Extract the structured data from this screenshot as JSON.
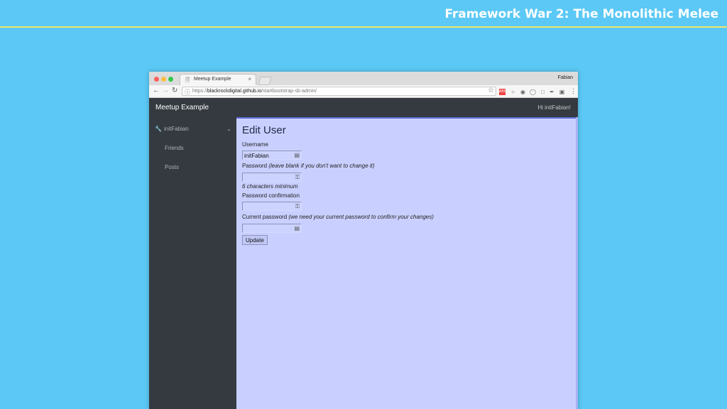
{
  "slide": {
    "title": "Framework War 2: The Monolithic Melee"
  },
  "browser": {
    "tab_title": "Meetup Example",
    "tab_icon": "page-icon",
    "profile_name": "Fabian",
    "url_prefix": "https://",
    "url_host": "blackrockdigital.github.io",
    "url_path": "/startbootstrap-sb-admin/"
  },
  "app": {
    "brand": "Meetup Example",
    "greeting": "Hi initFabian!",
    "sidebar": {
      "user_label": "initFabian",
      "items": [
        {
          "label": "Friends"
        },
        {
          "label": "Posts"
        }
      ]
    },
    "form": {
      "title": "Edit User",
      "username_label": "Username",
      "username_value": "initFabian",
      "password_label": "Password",
      "password_hint": "(leave blank if you don't want to change it)",
      "password_min": "6 characters minimum",
      "confirm_label": "Password confirmation",
      "current_label": "Current password",
      "current_hint": "(we need your current password to confirm your changes)",
      "submit_label": "Update"
    }
  },
  "colors": {
    "slide_bg": "#5bc8f5",
    "rule": "#f3e66c",
    "navbar": "#343a40",
    "content_bg": "#c9d0ff"
  }
}
